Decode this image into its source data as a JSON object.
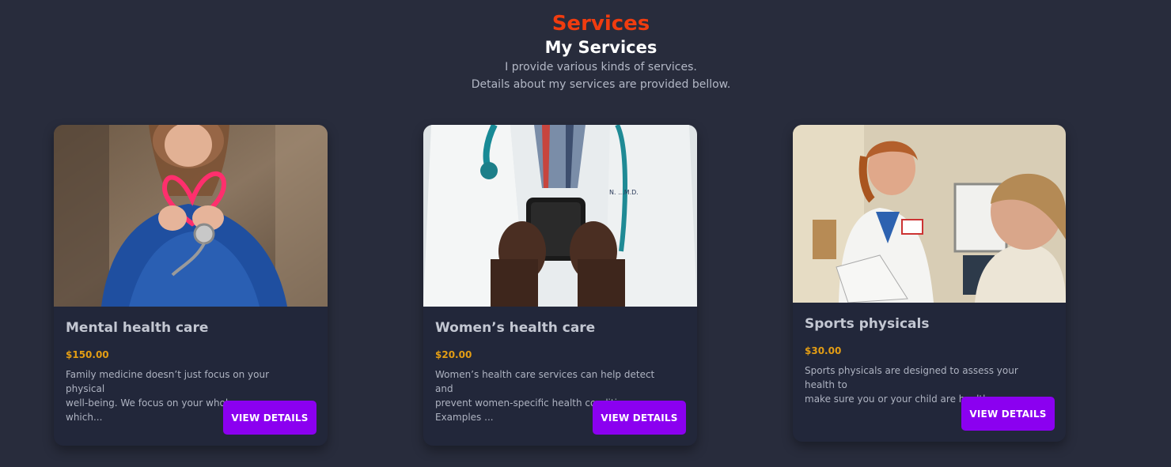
{
  "header": {
    "title": "Services",
    "subtitle": "My Services",
    "description_line1": "I provide various kinds of services.",
    "description_line2": "Details about my services are provided bellow."
  },
  "services": [
    {
      "title": "Mental health care",
      "price": "$150.00",
      "description_line1": "Family medicine doesn’t just focus on your physical",
      "description_line2": "well-being. We focus on your whole person, which...",
      "button_label": "VIEW DETAILS",
      "image": "person-holding-heart-stethoscope-photo"
    },
    {
      "title": "Women’s health care",
      "price": "$20.00",
      "description_line1": "Women’s health care services can help detect and",
      "description_line2": "prevent women-specific health conditions. Examples ...",
      "button_label": "VIEW DETAILS",
      "image": "doctor-using-smartphone-photo"
    },
    {
      "title": "Sports physicals",
      "price": "$30.00",
      "description_line1": "Sports physicals are designed to assess your health to",
      "description_line2": "make sure you or your child are healthy enoug...",
      "button_label": "VIEW DETAILS",
      "image": "doctor-talking-with-patient-photo"
    }
  ],
  "colors": {
    "background": "#282c3c",
    "card": "#22273a",
    "accent_title": "#f03c0f",
    "price": "#e39d14",
    "button": "#8b00f0"
  }
}
